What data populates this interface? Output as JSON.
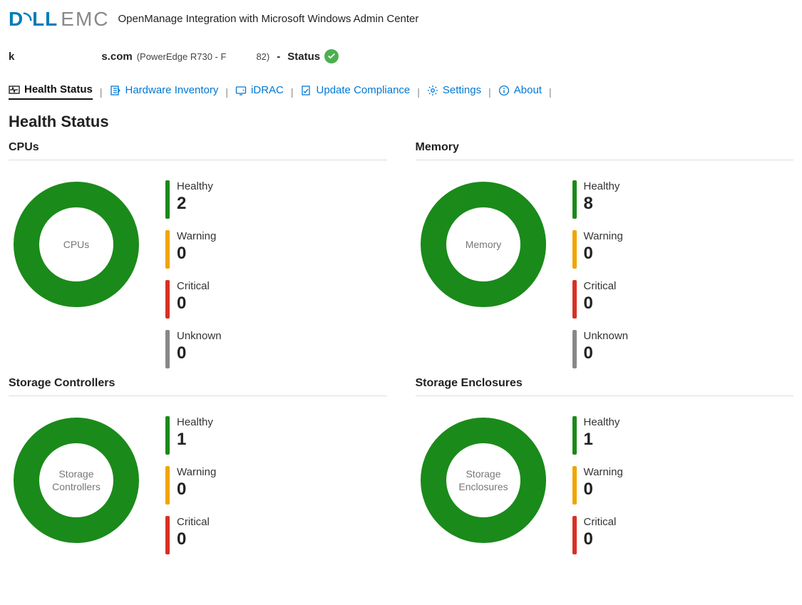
{
  "brand": {
    "dell": "D&#9693;LL",
    "emc": "EMC"
  },
  "app_title": "OpenManage Integration with Microsoft Windows Admin Center",
  "host": {
    "name_left": "k",
    "name_right": "s.com",
    "subtitle_left": "(PowerEdge R730 - F",
    "subtitle_right": "82)",
    "dash": "-",
    "status_label": "Status"
  },
  "tabs": [
    {
      "label": "Health Status",
      "active": true
    },
    {
      "label": "Hardware Inventory",
      "active": false
    },
    {
      "label": "iDRAC",
      "active": false
    },
    {
      "label": "Update Compliance",
      "active": false
    },
    {
      "label": "Settings",
      "active": false
    },
    {
      "label": "About",
      "active": false
    }
  ],
  "page_heading": "Health Status",
  "stat_labels": {
    "healthy": "Healthy",
    "warning": "Warning",
    "critical": "Critical",
    "unknown": "Unknown"
  },
  "cards": [
    {
      "title": "CPUs",
      "center": "CPUs",
      "healthy": 2,
      "warning": 0,
      "critical": 0,
      "unknown": 0,
      "show_unknown": true
    },
    {
      "title": "Memory",
      "center": "Memory",
      "healthy": 8,
      "warning": 0,
      "critical": 0,
      "unknown": 0,
      "show_unknown": true
    },
    {
      "title": "Storage Controllers",
      "center": "Storage Controllers",
      "healthy": 1,
      "warning": 0,
      "critical": 0,
      "unknown": 0,
      "show_unknown": false
    },
    {
      "title": "Storage Enclosures",
      "center": "Storage Enclosures",
      "healthy": 1,
      "warning": 0,
      "critical": 0,
      "unknown": 0,
      "show_unknown": false
    }
  ],
  "chart_data": [
    {
      "type": "pie",
      "title": "CPUs",
      "categories": [
        "Healthy",
        "Warning",
        "Critical",
        "Unknown"
      ],
      "values": [
        2,
        0,
        0,
        0
      ]
    },
    {
      "type": "pie",
      "title": "Memory",
      "categories": [
        "Healthy",
        "Warning",
        "Critical",
        "Unknown"
      ],
      "values": [
        8,
        0,
        0,
        0
      ]
    },
    {
      "type": "pie",
      "title": "Storage Controllers",
      "categories": [
        "Healthy",
        "Warning",
        "Critical"
      ],
      "values": [
        1,
        0,
        0
      ]
    },
    {
      "type": "pie",
      "title": "Storage Enclosures",
      "categories": [
        "Healthy",
        "Warning",
        "Critical"
      ],
      "values": [
        1,
        0,
        0
      ]
    }
  ],
  "colors": {
    "healthy": "#1a8a1a",
    "warning": "#f0a500",
    "critical": "#d93025",
    "unknown": "#888888",
    "link": "#0078d4"
  }
}
